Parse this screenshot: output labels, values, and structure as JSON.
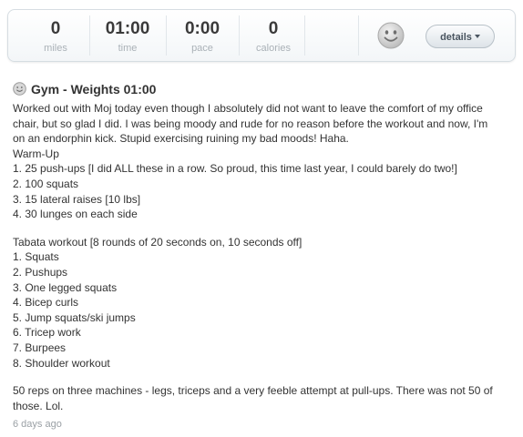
{
  "stats": [
    {
      "value": "0",
      "label": "miles"
    },
    {
      "value": "01:00",
      "label": "time"
    },
    {
      "value": "0:00",
      "label": "pace"
    },
    {
      "value": "0",
      "label": "calories"
    }
  ],
  "mood_icon": "smiley-face-icon",
  "details_button": "details",
  "entry": {
    "title": "Gym - Weights 01:00",
    "intro": [
      "Worked out with Moj today even though I absolutely did not want to leave the comfort of my office",
      "chair, but so glad I did. I was being moody and rude for no reason before the workout and now, I'm",
      "on an endorphin kick. Stupid exercising ruining my bad moods! Haha."
    ],
    "warmup_heading": "Warm-Up",
    "warmup": [
      "1. 25 push-ups [I did ALL these in a row. So proud, this time last year, I could barely do two!]",
      "2. 100 squats",
      "3. 15 lateral raises [10 lbs]",
      "4. 30 lunges on each side"
    ],
    "tabata_heading": "Tabata workout [8 rounds of 20 seconds on, 10 seconds off]",
    "tabata": [
      "1. Squats",
      "2. Pushups",
      "3. One legged squats",
      "4. Bicep curls",
      "5. Jump squats/ski jumps",
      "6. Tricep work",
      "7. Burpees",
      "8. Shoulder workout"
    ],
    "closing": [
      "50 reps on three machines - legs, triceps and a very feeble attempt at pull-ups. There was not 50 of",
      "those. Lol."
    ],
    "posted": "6 days ago"
  }
}
